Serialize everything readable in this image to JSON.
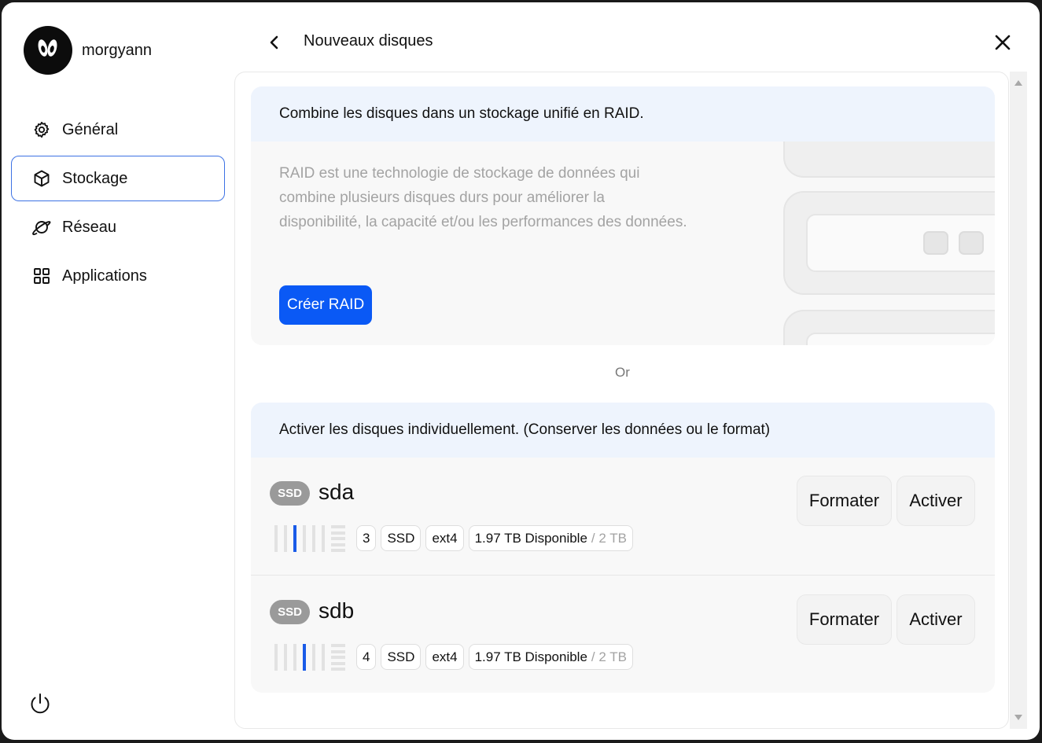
{
  "user": {
    "name": "morgyann"
  },
  "sidebar": {
    "items": [
      {
        "label": "Général",
        "icon": "gear-icon"
      },
      {
        "label": "Stockage",
        "icon": "cube-icon",
        "active": true
      },
      {
        "label": "Réseau",
        "icon": "planet-icon"
      },
      {
        "label": "Applications",
        "icon": "grid-icon"
      }
    ]
  },
  "header": {
    "title": "Nouveaux disques"
  },
  "raid": {
    "heading": "Combine les disques dans un stockage unifié en RAID.",
    "description": "RAID est une technologie de stockage de données qui combine plusieurs disques durs pour améliorer la disponibilité, la capacité et/ou les performances des données.",
    "button": "Créer RAID"
  },
  "separator": "Or",
  "individual": {
    "heading": "Activer les disques individuellement. (Conserver les données ou le format)",
    "disks": [
      {
        "badge": "SSD",
        "name": "sda",
        "slot_index": 3,
        "slot": "3",
        "type": "SSD",
        "fs": "ext4",
        "available": "1.97 TB Disponible",
        "total": "/ 2 TB",
        "format_label": "Formater",
        "activate_label": "Activer"
      },
      {
        "badge": "SSD",
        "name": "sdb",
        "slot_index": 4,
        "slot": "4",
        "type": "SSD",
        "fs": "ext4",
        "available": "1.97 TB Disponible",
        "total": "/ 2 TB",
        "format_label": "Formater",
        "activate_label": "Activer"
      }
    ]
  },
  "colors": {
    "accent": "#0a59f5",
    "active_border": "#3d72e4",
    "card_head": "#eef4fd",
    "slot_active": "#1a5be8"
  }
}
